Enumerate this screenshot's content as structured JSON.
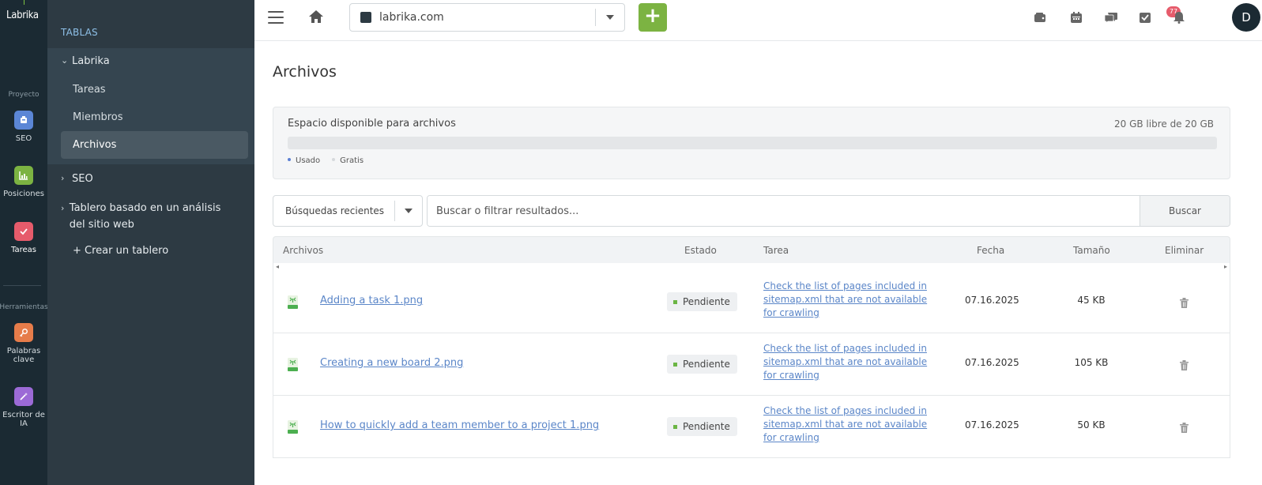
{
  "app": {
    "logo": "Labrika"
  },
  "rail": {
    "proyecto_label": "Proyecto",
    "herramientas_label": "Herramientas",
    "items": [
      {
        "label": "SEO",
        "color": "#5b86d6"
      },
      {
        "label": "Posiciones",
        "color": "#7cb342"
      },
      {
        "label": "Tareas",
        "color": "#e65b6b"
      },
      {
        "label": "Palabras clave",
        "color": "#e67c4a"
      },
      {
        "label": "Escritor de IA",
        "color": "#9c6ad6"
      }
    ]
  },
  "sidebar": {
    "heading": "TABLAS",
    "board_name": "Labrika",
    "sub_items": [
      "Tareas",
      "Miembros",
      "Archivos"
    ],
    "other_items": [
      "SEO",
      "Tablero basado en un análisis del sitio web"
    ],
    "create_board": "+ Crear un tablero"
  },
  "topbar": {
    "project": "labrika.com",
    "add_label": "+",
    "notif_count": "77",
    "avatar_letter": "D"
  },
  "page": {
    "title": "Archivos",
    "storage": {
      "label": "Espacio disponible para archivos",
      "free_text": "20 GB libre de 20 GB",
      "used_fraction": 0,
      "legend_used": "Usado",
      "legend_free": "Gratis",
      "used_color": "#5b7fd4",
      "free_color": "#d6d9dc"
    },
    "filter": {
      "recent_label": "Búsquedas recientes",
      "search_placeholder": "Buscar o filtrar resultados...",
      "search_button": "Buscar"
    },
    "table": {
      "columns": [
        "Archivos",
        "Estado",
        "Tarea",
        "Fecha",
        "Tamaño",
        "Eliminar"
      ],
      "scroll_left": "◂",
      "scroll_right": "▸",
      "rows": [
        {
          "file": "Adding a task 1.png",
          "status": "Pendiente",
          "task": "Check the list of pages included in sitemap.xml that are not available for crawling",
          "date": "07.16.2025",
          "size": "45 KB"
        },
        {
          "file": "Creating a new board 2.png",
          "status": "Pendiente",
          "task": "Check the list of pages included in sitemap.xml that are not available for crawling",
          "date": "07.16.2025",
          "size": "105 KB"
        },
        {
          "file": "How to quickly add a team member to a project 1.png",
          "status": "Pendiente",
          "task": "Check the list of pages included in sitemap.xml that are not available for crawling",
          "date": "07.16.2025",
          "size": "50 KB"
        }
      ]
    }
  }
}
